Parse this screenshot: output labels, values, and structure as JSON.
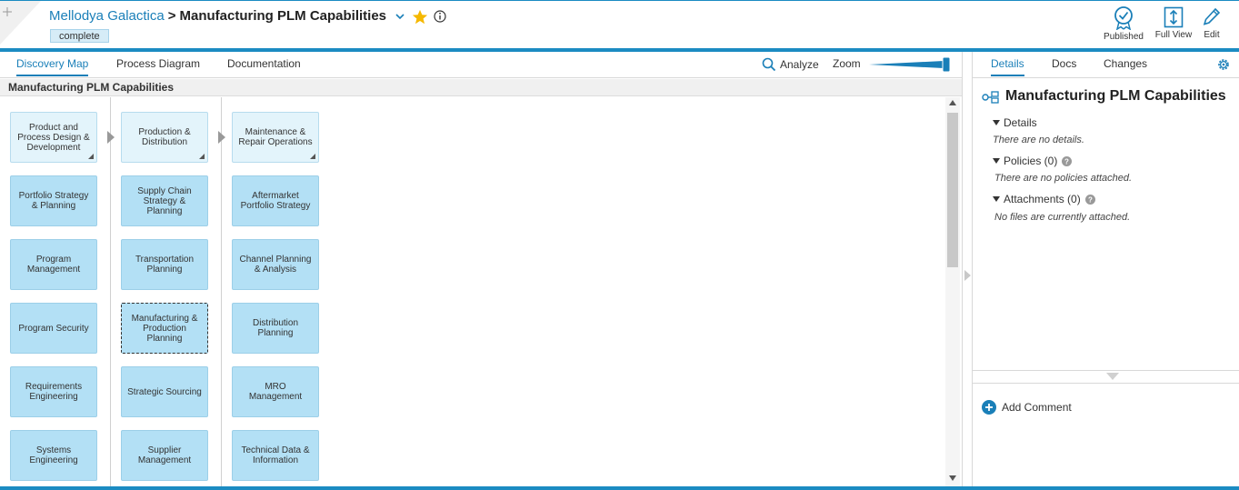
{
  "header": {
    "breadcrumb_parent": "Mellodya Galactica",
    "breadcrumb_separator": ">",
    "title": "Manufacturing PLM Capabilities",
    "status": "complete",
    "actions": {
      "published": "Published",
      "full_view": "Full View",
      "edit": "Edit"
    },
    "accent_color": "#1b8bc2",
    "star_color": "#f5b800"
  },
  "tabs": {
    "discovery_map": "Discovery Map",
    "process_diagram": "Process Diagram",
    "documentation": "Documentation",
    "active": "Discovery Map"
  },
  "toolbar": {
    "analyze": "Analyze",
    "zoom": "Zoom"
  },
  "map": {
    "title": "Manufacturing PLM Capabilities",
    "columns": [
      {
        "header": "Product and Process Design & Development",
        "items": [
          "Portfolio Strategy & Planning",
          "Program Management",
          "Program Security",
          "Requirements Engineering",
          "Systems Engineering"
        ]
      },
      {
        "header": "Production & Distribution",
        "items": [
          "Supply Chain Strategy & Planning",
          "Transportation Planning",
          "Manufacturing & Production Planning",
          "Strategic Sourcing",
          "Supplier Management"
        ]
      },
      {
        "header": "Maintenance & Repair Operations",
        "items": [
          "Aftermarket Portfolio Strategy",
          "Channel Planning & Analysis",
          "Distribution Planning",
          "MRO Management",
          "Technical Data & Information"
        ]
      }
    ],
    "selected_item": "Manufacturing & Production Planning",
    "card_color": "#b3e0f5",
    "header_card_color": "#e3f4fb"
  },
  "details_panel": {
    "tabs": {
      "details": "Details",
      "docs": "Docs",
      "changes": "Changes",
      "active": "Details"
    },
    "title": "Manufacturing PLM Capabilities",
    "sections": {
      "details_label": "Details",
      "details_empty": "There are no details.",
      "policies_label": "Policies (0)",
      "policies_empty": "There are no policies attached.",
      "attachments_label": "Attachments (0)",
      "attachments_empty": "No files are currently attached."
    },
    "add_comment": "Add Comment"
  }
}
